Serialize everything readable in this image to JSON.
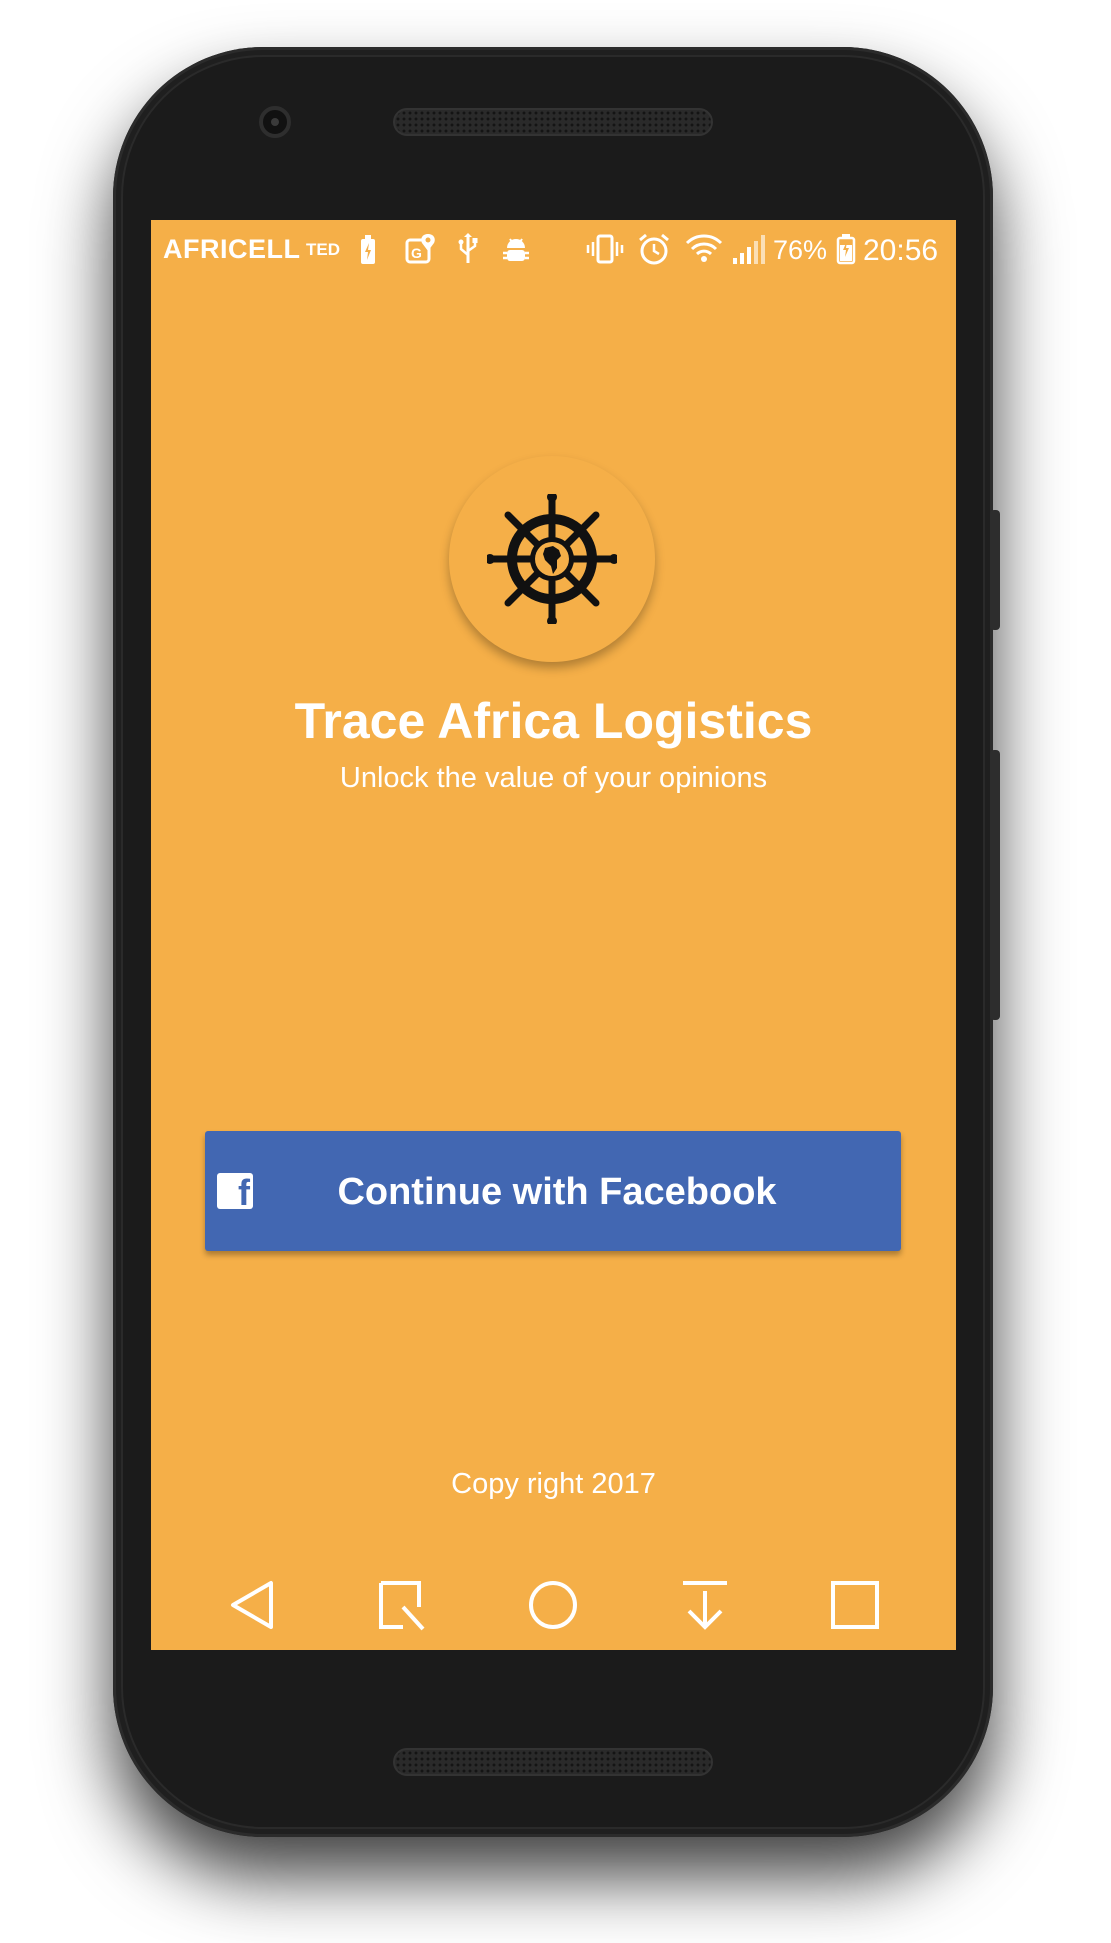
{
  "status_bar": {
    "carrier": "AFRICELL",
    "ted": "TED",
    "battery_percent": "76%",
    "time": "20:56",
    "icons": [
      "battery-charging-icon",
      "maps-icon",
      "usb-icon",
      "android-debug-icon",
      "vibrate-icon",
      "alarm-icon",
      "wifi-icon",
      "signal-icon",
      "battery-icon"
    ]
  },
  "app": {
    "logo_icon": "ship-wheel-africa-icon",
    "title": "Trace Africa Logistics",
    "subtitle": "Unlock the value of your opinions"
  },
  "login": {
    "facebook_label": "Continue with Facebook",
    "facebook_icon_glyph": "f",
    "facebook_color": "#4267b2"
  },
  "footer": {
    "copyright": "Copy right 2017"
  },
  "nav": {
    "buttons": [
      "back-icon",
      "screenshot-icon",
      "home-icon",
      "download-icon",
      "recents-icon"
    ]
  },
  "colors": {
    "background": "#f5af48",
    "accent": "#4267b2"
  }
}
